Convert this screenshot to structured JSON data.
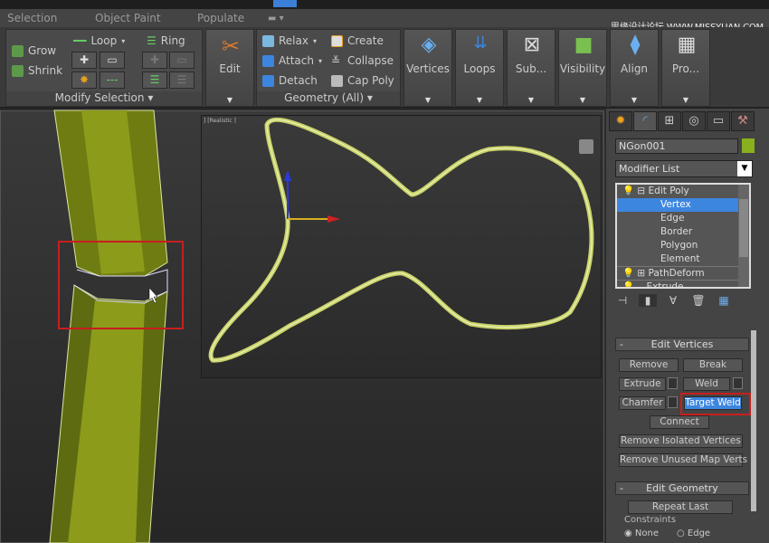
{
  "tabs": {
    "selection": "Selection",
    "object_paint": "Object Paint",
    "populate": "Populate"
  },
  "watermark": "思缘设计论坛 WWW.MISSYUAN.COM",
  "ribbon": {
    "modify_selection": {
      "grow": "Grow",
      "shrink": "Shrink",
      "loop": "Loop",
      "ring": "Ring",
      "footer": "Modify Selection"
    },
    "edit": {
      "label": "Edit"
    },
    "geometry": {
      "relax": "Relax",
      "attach": "Attach",
      "detach": "Detach",
      "create": "Create",
      "collapse": "Collapse",
      "cap_poly": "Cap Poly",
      "footer": "Geometry (All)"
    },
    "big_buttons": [
      "Vertices",
      "Loops",
      "Sub...",
      "Visibility",
      "Align",
      "Pro..."
    ]
  },
  "viewport": {
    "label": "] [Realistic ]",
    "object_color": "#8a9a1a"
  },
  "command_panel": {
    "object_name": "NGon001",
    "object_color": "#8ab020",
    "modifier_list": "Modifier List",
    "stack": [
      "Edit Poly",
      "Vertex",
      "Edge",
      "Border",
      "Polygon",
      "Element",
      "PathDeform",
      "Extrude"
    ],
    "selected_stack_item": "Vertex",
    "edit_vertices": {
      "title": "Edit Vertices",
      "collapse": "-",
      "remove": "Remove",
      "break": "Break",
      "extrude": "Extrude",
      "weld": "Weld",
      "chamfer": "Chamfer",
      "target_weld": "Target Weld",
      "connect": "Connect",
      "remove_isolated": "Remove Isolated Vertices",
      "remove_unused": "Remove Unused Map Verts"
    },
    "edit_geometry": {
      "title": "Edit Geometry",
      "collapse": "-",
      "repeat_last": "Repeat Last",
      "constraints": "Constraints",
      "none": "None",
      "edge": "Edge"
    }
  },
  "accent": "#3d86e0",
  "highlight": "#c81e1e"
}
